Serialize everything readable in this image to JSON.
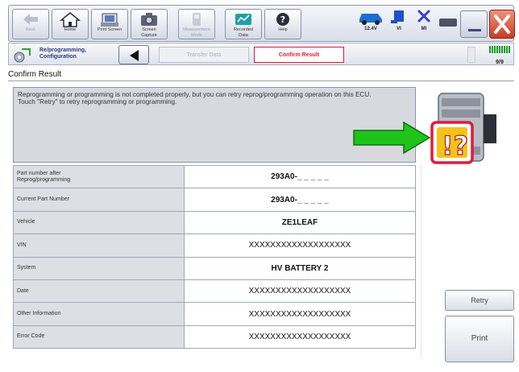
{
  "toolbar": {
    "buttons": [
      {
        "label": "Back",
        "icon": "back-arrow-icon",
        "enabled": false
      },
      {
        "label": "Home",
        "icon": "home-icon",
        "enabled": true
      },
      {
        "label": "Print Screen",
        "icon": "print-screen-icon",
        "enabled": true
      },
      {
        "label": "Screen\nCapture",
        "icon": "camera-icon",
        "enabled": true
      },
      {
        "label": "Measurement\nMode",
        "icon": "measurement-icon",
        "enabled": false
      },
      {
        "label": "Recorded\nData",
        "icon": "recorded-data-icon",
        "enabled": true
      },
      {
        "label": "Help",
        "icon": "help-icon",
        "enabled": true
      }
    ],
    "status": {
      "voltage": "12.4V",
      "vi": "VI",
      "mi": "MI"
    }
  },
  "navbar": {
    "breadcrumb": "Re/programming,\nConfiguration",
    "steps": [
      {
        "label": "Transfer Data",
        "active": false
      },
      {
        "label": "Confirm Result",
        "active": true
      }
    ],
    "progress": "9/9"
  },
  "section_title": "Confirm Result",
  "message": {
    "line1": "Reprogramming or programming is not completed properly, but you can retry reprog/programming operation on this ECU.",
    "line2": "Touch \"Retry\" to retry reprogramming or programming."
  },
  "results": [
    {
      "label": "Part number after\nReprog/programming",
      "value": "293A0-_ _ _ _ _",
      "bold": true
    },
    {
      "label": "Current Part Number",
      "value": "293A0-_ _ _ _ _",
      "bold": true
    },
    {
      "label": "Vehicle",
      "value": "ZE1LEAF",
      "bold": true
    },
    {
      "label": "VIN",
      "value": "XXXXXXXXXXXXXXXXXXX",
      "bold": false
    },
    {
      "label": "System",
      "value": "HV BATTERY 2",
      "bold": true
    },
    {
      "label": "Date",
      "value": "XXXXXXXXXXXXXXXXXXX",
      "bold": false
    },
    {
      "label": "Other Information",
      "value": "XXXXXXXXXXXXXXXXXXX",
      "bold": false
    },
    {
      "label": "Error Code",
      "value": "XXXXXXXXXXXXXXXXXXX",
      "bold": false
    }
  ],
  "actions": {
    "retry": "Retry",
    "print": "Print"
  },
  "colors": {
    "accent_red": "#e31a3a",
    "arrow_green": "#1fc31a",
    "warning_yellow": "#f4c21b"
  }
}
